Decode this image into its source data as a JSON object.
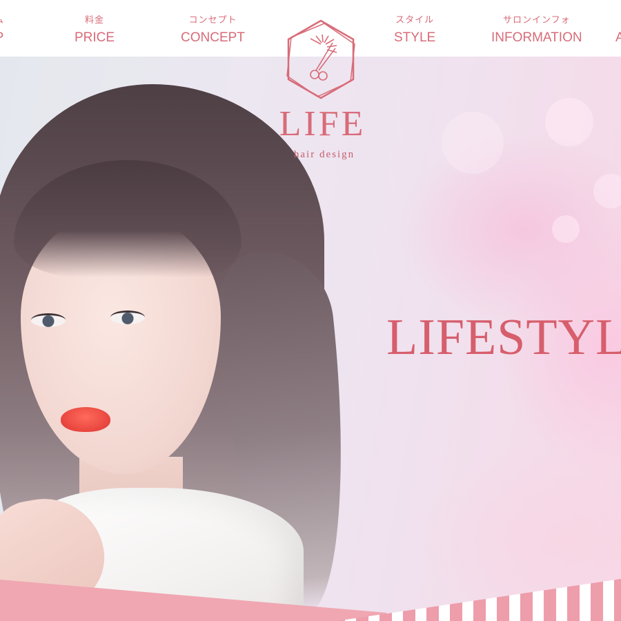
{
  "nav": {
    "items": [
      {
        "jp": "ム",
        "en": "P"
      },
      {
        "jp": "料金",
        "en": "PRICE"
      },
      {
        "jp": "コンセプト",
        "en": "CONCEPT"
      },
      {
        "jp": "スタイル",
        "en": "STYLE"
      },
      {
        "jp": "サロンインフォ",
        "en": "INFORMATION"
      },
      {
        "jp": "",
        "en": "A"
      }
    ]
  },
  "logo": {
    "title": "LIFE",
    "subtitle": "hair design",
    "icon": "scissors-hexagon-icon"
  },
  "hero": {
    "headline": "LIFESTYL"
  },
  "colors": {
    "accent": "#d86b78",
    "headline": "#d75e6c",
    "band_pink": "#f0a7b2",
    "stripe": "#ee9dab"
  }
}
